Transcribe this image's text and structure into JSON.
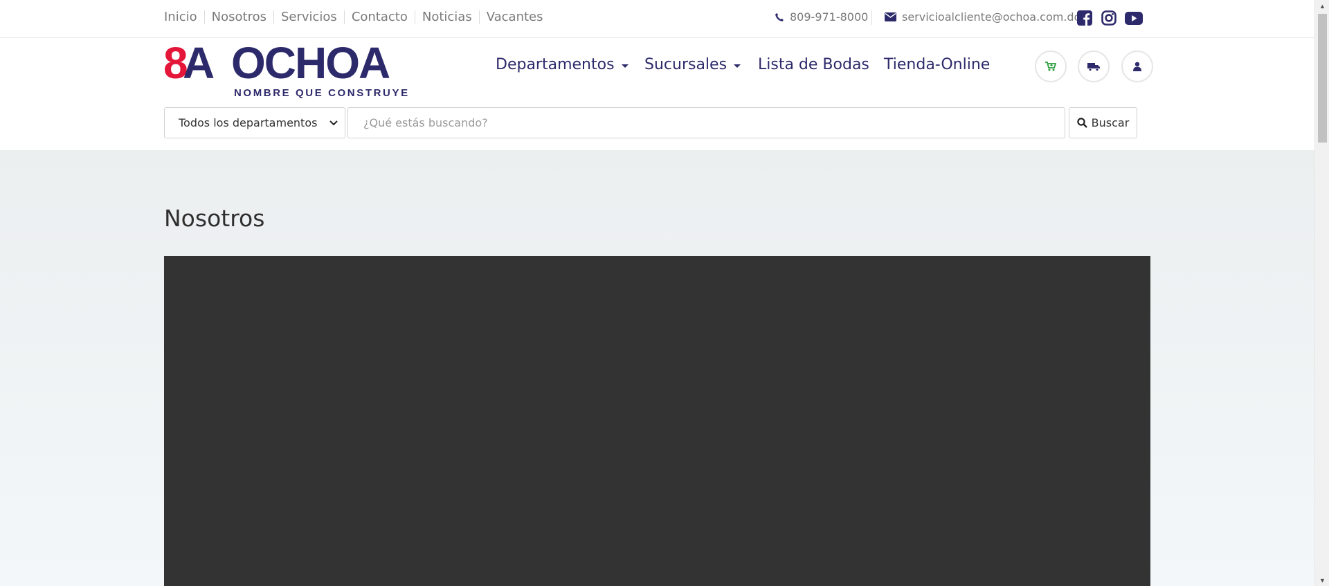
{
  "topbar": {
    "links": [
      "Inicio",
      "Nosotros",
      "Servicios",
      "Contacto",
      "Noticias",
      "Vacantes"
    ],
    "phone": "809-971-8000",
    "email": "servicioalcliente@ochoa.com.do",
    "social_icons": [
      "facebook-icon",
      "instagram-icon",
      "youtube-icon"
    ]
  },
  "header": {
    "logo_text": "OCHOA",
    "logo_number": "8A",
    "logo_tagline": "NOMBRE QUE CONSTRUYE",
    "nav": {
      "departamentos": "Departamentos",
      "sucursales": "Sucursales",
      "lista": "Lista de Bodas",
      "tienda": "Tienda-Online"
    },
    "action_icons": [
      "cart-icon",
      "truck-icon",
      "user-icon"
    ]
  },
  "search": {
    "department_selected": "Todos los departamentos",
    "placeholder": "¿Qué estás buscando?",
    "button_label": "Buscar"
  },
  "main": {
    "title": "Nosotros"
  },
  "colors": {
    "brand_navy": "#2d2a6b",
    "brand_red": "#e4163a",
    "cart_green": "#2e9e3e",
    "video_bg": "#333333"
  }
}
